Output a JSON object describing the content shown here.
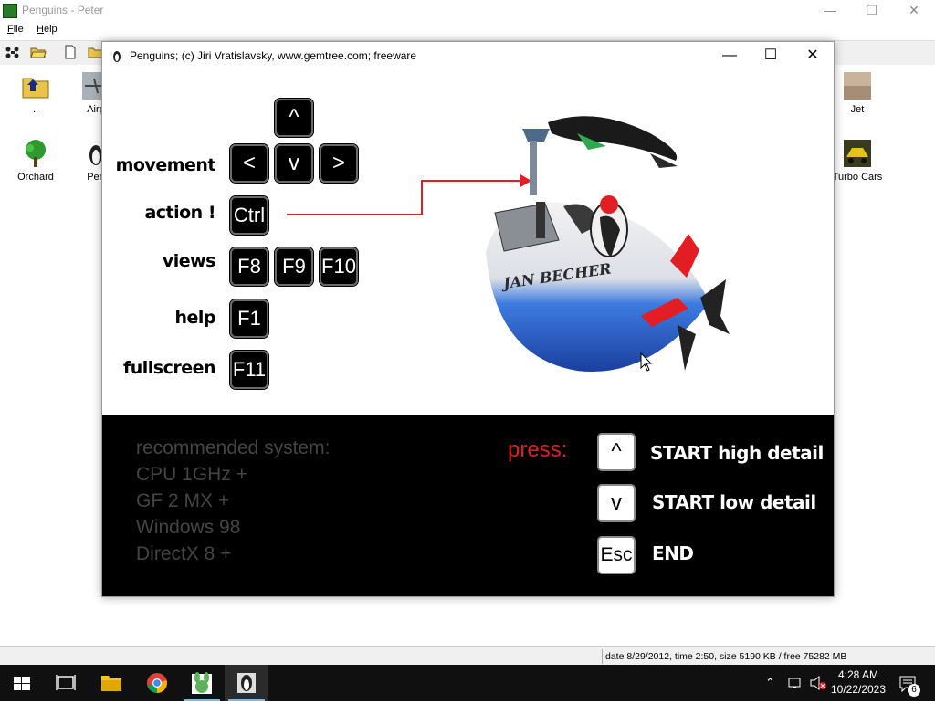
{
  "outer": {
    "title": "Penguins - Peter",
    "menu": [
      {
        "accel": "F",
        "rest": "ile"
      },
      {
        "accel": "H",
        "rest": "elp"
      }
    ],
    "icons": [
      {
        "label": ".."
      },
      {
        "label": "Airp"
      },
      {
        "label": "Jet"
      },
      {
        "label": "Orchard"
      },
      {
        "label": "Pen"
      },
      {
        "label": "Turbo Cars"
      }
    ],
    "status": "date 8/29/2012, time 2:50, size 5190 KB / free 75282 MB"
  },
  "game": {
    "title": "Penguins;  (c) Jiri Vratislavsky, www.gemtree.com;  freeware",
    "labels": {
      "movement": "movement",
      "action": "action !",
      "views": "views",
      "help": "help",
      "fullscreen": "fullscreen"
    },
    "keys": {
      "up": "^",
      "left": "<",
      "down": "v",
      "right": ">",
      "ctrl": "Ctrl",
      "f8": "F8",
      "f9": "F9",
      "f10": "F10",
      "f1": "F1",
      "f11": "F11"
    },
    "illustration_text": "JAN BECHER",
    "recommended": [
      "recommended system:",
      "CPU 1GHz +",
      "GF 2 MX +",
      "Windows 98",
      "DirectX 8 +"
    ],
    "press_label": "press:",
    "start_options": [
      {
        "key": "^",
        "label": "START high detail"
      },
      {
        "key": "v",
        "label": "START low detail"
      },
      {
        "key": "Esc",
        "label": "END"
      }
    ]
  },
  "taskbar": {
    "time": "4:28 AM",
    "date": "10/22/2023",
    "notification_count": "6"
  },
  "colors": {
    "press_red": "#e21e24",
    "arrow_red": "#e21e24",
    "panel_black": "#000000",
    "taskbar": "#101010"
  }
}
